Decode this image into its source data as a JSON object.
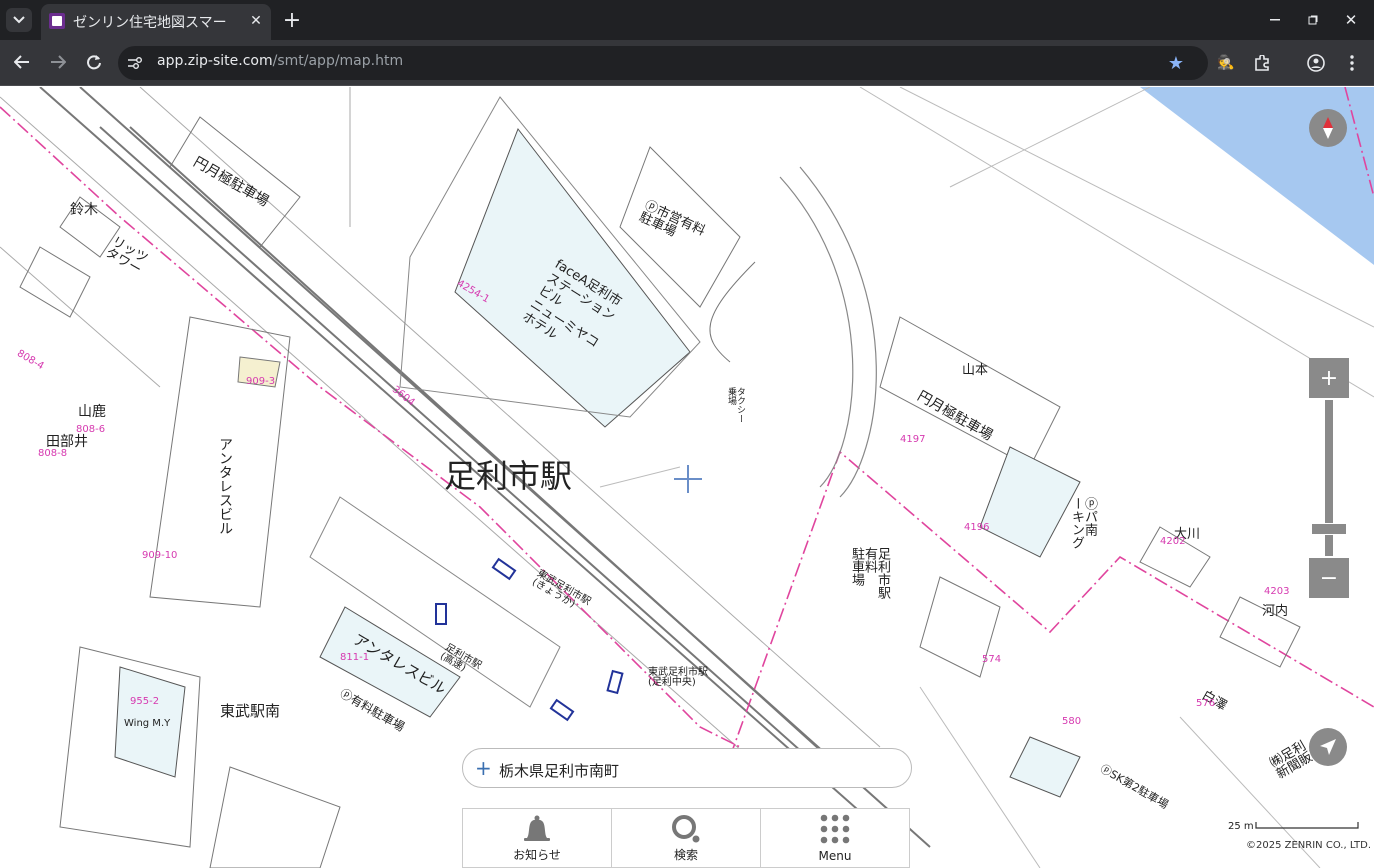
{
  "browser": {
    "tab_title": "ゼンリン住宅地図スマー",
    "url_host": "app.zip-site.com",
    "url_path": "/smt/app/map.htm"
  },
  "map": {
    "station_name": "足利市駅",
    "tobu_station": "東武駅南",
    "labels": {
      "parking_top": "円月極駐車場",
      "ichiei_parking": "ⓟ市営有料\n駐車場",
      "face_building": "faceA足利市\nステーション\nビル\nニューミヤコ\nホテル",
      "antares1": "アンタレスビル",
      "antares2": "アンタレスビル",
      "yamamoto": "山本",
      "tsukiji_parking": "円月極駐車場",
      "ekimae_parking": "足利市駅\n有料\n駐車場",
      "ookawa": "大川",
      "kouchi": "河内",
      "shirasawa": "白澤",
      "ashikaga_shinbun": "㈱足利\n新聞販売",
      "sk2_parking": "ⓟSK第2駐車場",
      "ppark": "ⓟパ南\nーキング",
      "wing": "Wing M.Y",
      "mtshika": "山鹿",
      "tabei": "田部井",
      "ritz": "リッツ\nタワー",
      "suzuki": "鈴木",
      "taxi": "タクシー\n乗場",
      "bus_kumagaya": "東武足利市駅\n(足利中央)",
      "bus_higashi": "東武足利市駅\n(きょうか)",
      "bus_kosoku": "足利市駅\n(高速)",
      "yuryo_parking": "ⓟ有料駐車場"
    },
    "plot_numbers": [
      "4254-1",
      "3604",
      "909-3",
      "808-4",
      "808-6",
      "808-8",
      "909-10",
      "811-1",
      "955-2",
      "4196",
      "4197",
      "574",
      "576",
      "580",
      "4202",
      "4203"
    ],
    "compass_icon": "compass-icon",
    "zoom_in": "+",
    "zoom_out": "−",
    "zoom_level": 0.27,
    "scale_label": "25 m",
    "copyright": "©2025 ZENRIN CO., LTD."
  },
  "search": {
    "address": "栃木県足利市南町"
  },
  "nav": {
    "items": [
      {
        "label": "お知らせ",
        "icon": "bell-icon"
      },
      {
        "label": "検索",
        "icon": "search-icon"
      },
      {
        "label": "Menu",
        "icon": "grid-icon"
      }
    ]
  },
  "colors": {
    "boundary": "#e0459e",
    "water": "#a6c8f0",
    "building_fill": "#eaf5f8",
    "control_gray": "#8a8a8a"
  }
}
